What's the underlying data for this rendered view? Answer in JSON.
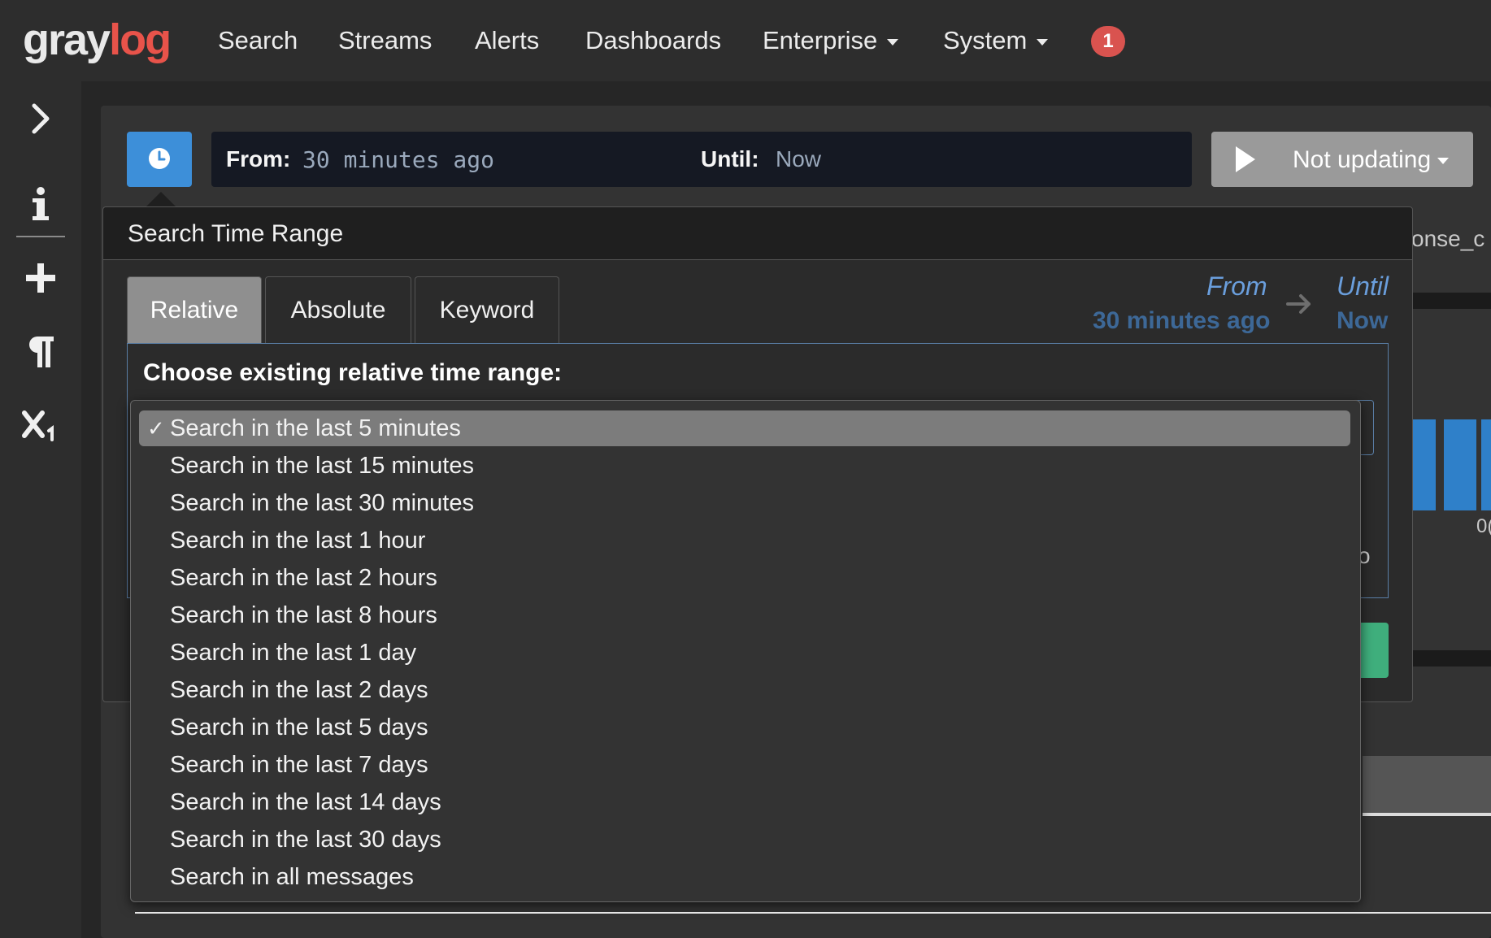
{
  "logo": {
    "part1": "gray",
    "part2": "log"
  },
  "nav": {
    "search": "Search",
    "streams": "Streams",
    "alerts": "Alerts",
    "dashboards": "Dashboards",
    "enterprise": "Enterprise",
    "system": "System",
    "notification_count": "1"
  },
  "sidebar": {
    "items": [
      {
        "icon": "chevron-right-icon"
      },
      {
        "icon": "info-icon"
      },
      {
        "icon": "plus-icon"
      },
      {
        "icon": "paragraph-icon"
      },
      {
        "icon": "subscript-icon"
      }
    ]
  },
  "timerange_bar": {
    "from_label": "From:",
    "from_value": "30 minutes ago",
    "until_label": "Until:",
    "until_value": "Now"
  },
  "refresh": {
    "label": "Not updating"
  },
  "background": {
    "field_snippet": "onse_c",
    "axis_snippet": "0(",
    "snippet_o": "o"
  },
  "popover": {
    "title": "Search Time Range",
    "tabs": [
      {
        "label": "Relative",
        "active": true
      },
      {
        "label": "Absolute",
        "active": false
      },
      {
        "label": "Keyword",
        "active": false
      }
    ],
    "summary": {
      "from_label": "From",
      "from_value": "30 minutes ago",
      "until_label": "Until",
      "until_value": "Now"
    },
    "choose_label": "Choose existing relative time range:",
    "options": [
      {
        "label": "Search in the last 5 minutes",
        "selected": true
      },
      {
        "label": "Search in the last 15 minutes",
        "selected": false
      },
      {
        "label": "Search in the last 30 minutes",
        "selected": false
      },
      {
        "label": "Search in the last 1 hour",
        "selected": false
      },
      {
        "label": "Search in the last 2 hours",
        "selected": false
      },
      {
        "label": "Search in the last 8 hours",
        "selected": false
      },
      {
        "label": "Search in the last 1 day",
        "selected": false
      },
      {
        "label": "Search in the last 2 days",
        "selected": false
      },
      {
        "label": "Search in the last 5 days",
        "selected": false
      },
      {
        "label": "Search in the last 7 days",
        "selected": false
      },
      {
        "label": "Search in the last 14 days",
        "selected": false
      },
      {
        "label": "Search in the last 30 days",
        "selected": false
      },
      {
        "label": "Search in all messages",
        "selected": false
      }
    ]
  },
  "colors": {
    "accent_blue": "#3d8fd9",
    "logo_red": "#e8534a",
    "badge_red": "#d9534f",
    "apply_green": "#3fae7c"
  }
}
